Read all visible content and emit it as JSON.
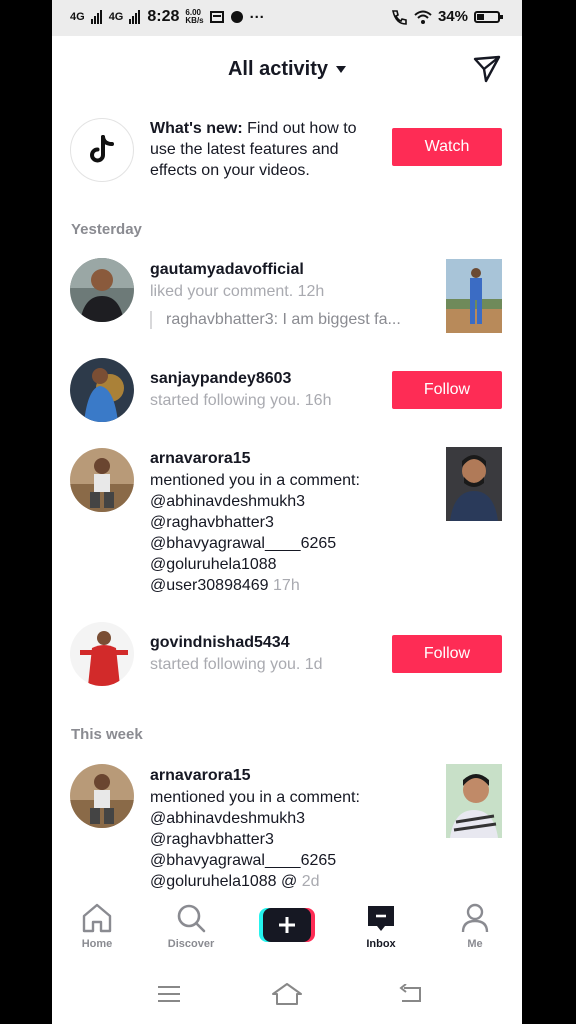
{
  "status_bar": {
    "network_1": "4G",
    "network_2": "4G",
    "time": "8:28",
    "speed_value": "6.00",
    "speed_unit": "KB/s",
    "dots": "···",
    "battery": "34%"
  },
  "header": {
    "title": "All activity"
  },
  "whats_new": {
    "bold": "What's new:",
    "text": "Find out how to use the latest features and effects on your videos.",
    "button": "Watch"
  },
  "sections": {
    "yesterday": "Yesterday",
    "this_week": "This week"
  },
  "notifications": [
    {
      "username": "gautamyadavofficial",
      "action": "liked your comment.",
      "time": "12h",
      "quote": "raghavbhatter3: I am biggest fa..."
    },
    {
      "username": "sanjaypandey8603",
      "action": "started following you.",
      "time": "16h",
      "button": "Follow"
    },
    {
      "username": "arnavarora15",
      "lines": [
        "mentioned you in a comment:",
        "@abhinavdeshmukh3",
        "@raghavbhatter3",
        "@bhavyagrawal____6265",
        "@goluruhela1088",
        "@user30898469"
      ],
      "time": "17h"
    },
    {
      "username": "govindnishad5434",
      "action": "started following you.",
      "time": "1d",
      "button": "Follow"
    },
    {
      "username": "arnavarora15",
      "lines": [
        "mentioned you in a comment:",
        "@abhinavdeshmukh3",
        "@raghavbhatter3",
        "@bhavyagrawal____6265",
        "@goluruhela1088 @"
      ],
      "time": "2d"
    }
  ],
  "tabs": {
    "home": "Home",
    "discover": "Discover",
    "inbox": "Inbox",
    "me": "Me"
  },
  "colors": {
    "accent": "#fe2c55",
    "muted": "#a9aab0"
  }
}
